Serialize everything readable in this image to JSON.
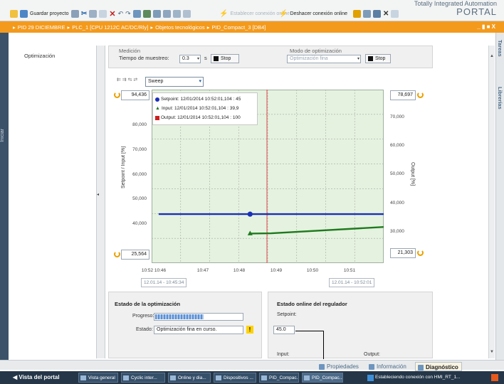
{
  "toolbar": {
    "save_label": "Guardar proyecto",
    "connect_label": "Establecer conexión online",
    "disconnect_label": "Deshacer conexión online"
  },
  "brand": {
    "line1": "Totally Integrated Automation",
    "line2": "PORTAL"
  },
  "breadcrumb": {
    "items": [
      "PID 29 DICIEMBRE",
      "PLC_1 [CPU 1212C AC/DC/Rly]",
      "Objetos tecnológicos",
      "PID_Compact_3 [DB4]"
    ],
    "separator": "▸",
    "window_controls": "_ ▮ ■ X"
  },
  "side": {
    "left_label": "Iniciar",
    "right_tabs": [
      "Tareas",
      "Librerías"
    ]
  },
  "nav": {
    "item": "Optimización"
  },
  "measure": {
    "title": "Medición",
    "sample_label": "Tiempo de muestreo:",
    "sample_value": "0.3",
    "unit": "s",
    "stop_label": "Stop",
    "mode_title": "Modo de optimización",
    "mode_value": "Optimización fina",
    "stop2_label": "Stop"
  },
  "chart_toolbar": {
    "icons": "⇇ ⇉ ⇆ ⇄",
    "mode": "Sweep"
  },
  "chart_data": {
    "type": "line",
    "left_axis": {
      "label": "Setpoint / Input [%]",
      "max_box": "94,436",
      "min_box": "25,564",
      "ticks": [
        "80,000",
        "70,000",
        "60,000",
        "50,000",
        "40,000"
      ],
      "ylim": [
        25.564,
        94.436
      ]
    },
    "right_axis": {
      "label": "Output [%]",
      "max_box": "78,697",
      "min_box": "21,303",
      "ticks": [
        "70,000",
        "60,000",
        "50,000",
        "40,000",
        "30,000"
      ],
      "ylim": [
        21.303,
        78.697
      ]
    },
    "x_ticks": [
      "10:52 10:46",
      "10:47",
      "10:48",
      "10:49",
      "10:50",
      "10:51"
    ],
    "x_range": {
      "start": "12.01.14 - 10:45:34",
      "end": "12.01.14 - 10:52:01"
    },
    "series": [
      {
        "name": "Setpoint",
        "legend": "Setpoint:  12/01/2014 10:52:01,104 : 45",
        "color": "#1a2fb8",
        "x": [
          10.8,
          11.45,
          11.45,
          12.4
        ],
        "y": [
          45,
          45,
          45,
          45
        ]
      },
      {
        "name": "Input",
        "legend": "Input:  12/01/2014 10:52:01,104 : 39,9",
        "color": "#1e7a1e",
        "x": [
          11.45,
          11.6,
          12.4
        ],
        "y": [
          37.3,
          37.4,
          39.9
        ]
      },
      {
        "name": "Output",
        "legend": "Output:  12/01/2014 10:52:01,104 : 100",
        "color": "#cc2020",
        "x": [],
        "y": []
      }
    ]
  },
  "opt": {
    "title": "Estado de la optimización",
    "progress_label": "Progreso:",
    "progress": 0.55,
    "status_label": "Estado:",
    "status_value": "Optimización fina en curso.",
    "warn": "!"
  },
  "online": {
    "title": "Estado online del regulador",
    "setpoint_label": "Setpoint:",
    "setpoint_value": "45.0",
    "input_label": "Input:",
    "output_label": "Output:"
  },
  "panel_tabs": {
    "props": "Propiedades",
    "info": "Información",
    "diag": "Diagnóstico"
  },
  "taskbar": {
    "portal": "◀  Vista del portal",
    "items": [
      "Vista general",
      "Cyclic inter...",
      "Online y dia...",
      "Dispositivos ...",
      "PID_Compac...",
      "PID_Compac..."
    ],
    "status": "Estableciendo conexión con HMI_RT_1..."
  }
}
